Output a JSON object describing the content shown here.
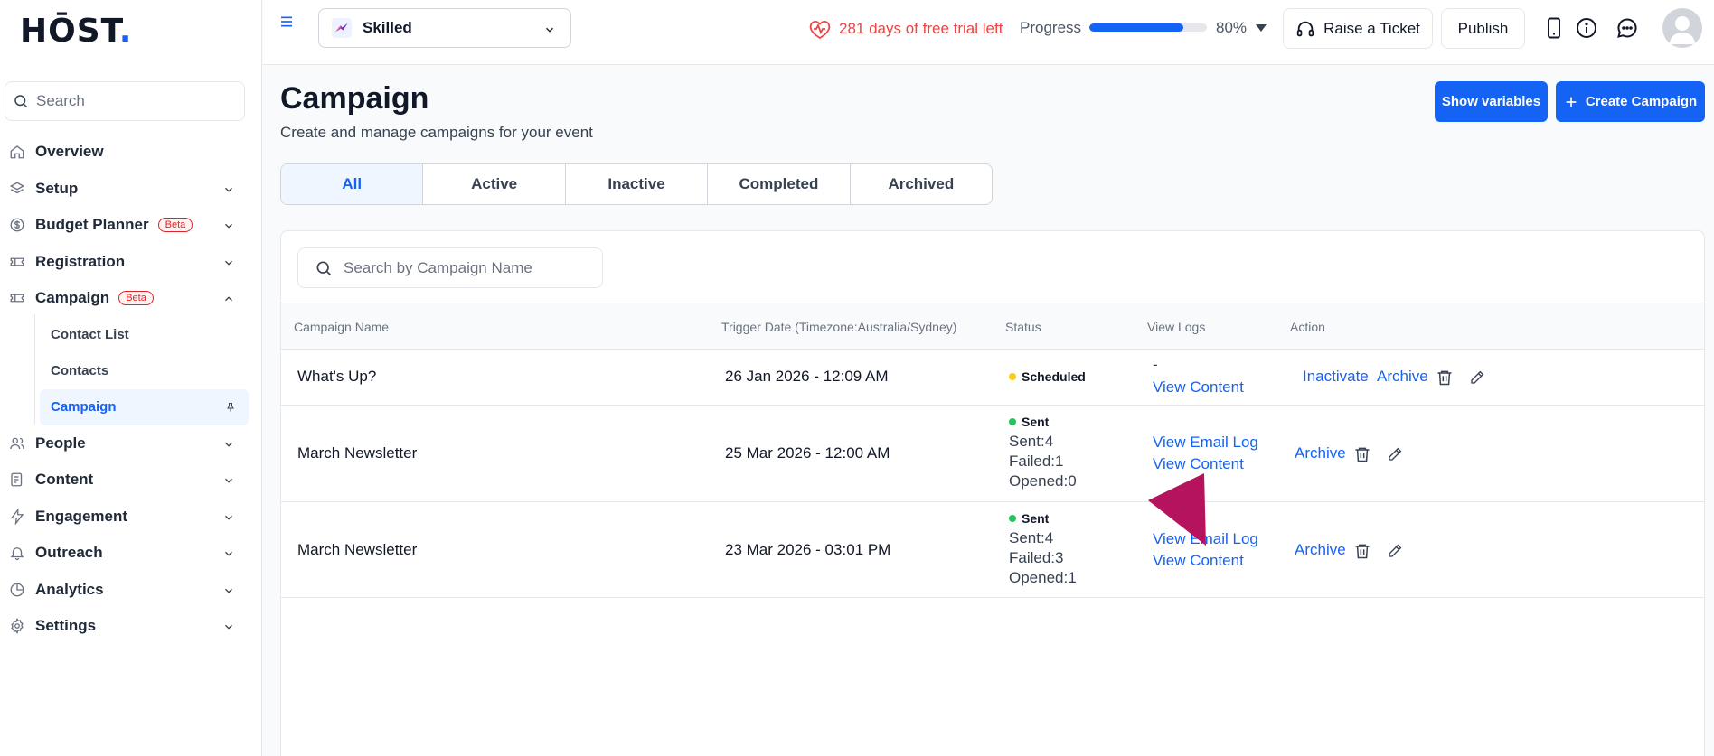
{
  "brand": {
    "logo_main": "HŌST",
    "logo_dot": ".",
    "accent": "#1463f5"
  },
  "sidebar": {
    "search_placeholder": "Search",
    "items": [
      {
        "label": "Overview",
        "icon": "home-icon",
        "expandable": false
      },
      {
        "label": "Setup",
        "icon": "layers-icon",
        "expandable": true
      },
      {
        "label": "Budget Planner",
        "icon": "dollar-circle-icon",
        "badge": "Beta",
        "expandable": true
      },
      {
        "label": "Registration",
        "icon": "ticket-icon",
        "expandable": true
      },
      {
        "label": "Campaign",
        "icon": "campaign-icon",
        "badge": "Beta",
        "expandable": true,
        "expanded": true,
        "children": [
          {
            "label": "Contact List"
          },
          {
            "label": "Contacts"
          },
          {
            "label": "Campaign",
            "active": true
          }
        ]
      },
      {
        "label": "People",
        "icon": "people-icon",
        "expandable": true
      },
      {
        "label": "Content",
        "icon": "document-icon",
        "expandable": true
      },
      {
        "label": "Engagement",
        "icon": "bolt-icon",
        "expandable": true
      },
      {
        "label": "Outreach",
        "icon": "bell-icon",
        "expandable": true
      },
      {
        "label": "Analytics",
        "icon": "pie-chart-icon",
        "expandable": true
      },
      {
        "label": "Settings",
        "icon": "gear-icon",
        "expandable": true
      }
    ]
  },
  "header": {
    "event_name": "Skilled",
    "trial_text": "281 days of free trial left",
    "progress_label": "Progress",
    "progress_value": 0.8,
    "progress_text": "80%",
    "ticket_label": "Raise a Ticket",
    "publish_label": "Publish"
  },
  "page": {
    "title": "Campaign",
    "subtitle": "Create and manage campaigns for your event",
    "show_variables_label": "Show variables",
    "create_label": "Create Campaign",
    "tabs": [
      {
        "label": "All",
        "active": true
      },
      {
        "label": "Active"
      },
      {
        "label": "Inactive"
      },
      {
        "label": "Completed"
      },
      {
        "label": "Archived"
      }
    ]
  },
  "table": {
    "search_placeholder": "Search by Campaign Name",
    "headers": {
      "name": "Campaign Name",
      "trigger": "Trigger Date (Timezone:Australia/Sydney)",
      "status": "Status",
      "logs": "View Logs",
      "action": "Action"
    },
    "rows": [
      {
        "name": "What's Up?",
        "trigger": "26 Jan 2026 - 12:09 AM",
        "status": "Scheduled",
        "status_color": "#facc15",
        "log_dash": "-",
        "view_content": "View Content",
        "inactivate": "Inactivate",
        "archive": "Archive"
      },
      {
        "name": "March Newsletter",
        "trigger": "25 Mar 2026 - 12:00 AM",
        "status": "Sent",
        "status_color": "#22c55e",
        "sent": "Sent:4",
        "failed": "Failed:1",
        "opened": "Opened:0",
        "view_email_log": "View Email Log",
        "view_content": "View Content",
        "archive": "Archive"
      },
      {
        "name": "March Newsletter",
        "trigger": "23 Mar 2026 - 03:01 PM",
        "status": "Sent",
        "status_color": "#22c55e",
        "sent": "Sent:4",
        "failed": "Failed:3",
        "opened": "Opened:1",
        "view_email_log": "View Email Log",
        "view_content": "View Content",
        "archive": "Archive"
      }
    ]
  }
}
